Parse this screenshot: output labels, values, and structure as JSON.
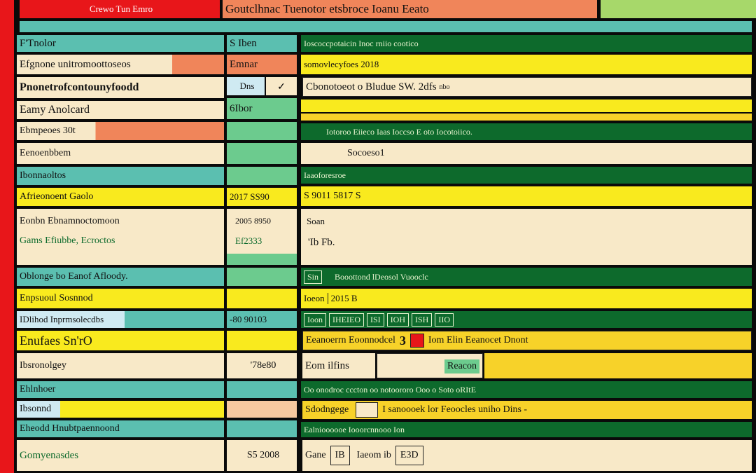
{
  "colors": {
    "red": "#e8161a",
    "teal": "#5bbfb0",
    "yellow": "#f9ea1e",
    "dark_green": "#0d6a2c",
    "gold": "#f7d229",
    "cream": "#f8e9c8",
    "orange": "#f0855a",
    "green": "#6ccb8e"
  },
  "header": {
    "left_tab": "Crewo Tun Emro",
    "center_title": "Goutclhnac Tuenotor etsbroce Ioanu Eeato"
  },
  "left": {
    "col1_header": "F'Tnolor",
    "col2_header": "S Iben",
    "rows": [
      {
        "label": "Efgnone unitromoottoseos",
        "value": "Emnar"
      },
      {
        "label": "Pnonetrofcontounyfoodd",
        "value": "Dns"
      },
      {
        "label": "Eamy Anolcard",
        "value": "6Ibor"
      },
      {
        "label": "Ebmpeoes 30t",
        "value": ""
      },
      {
        "label": "Eenoenbbem",
        "value": ""
      },
      {
        "label": "Ibonnaoltos",
        "value": ""
      },
      {
        "label": "Afrieonoent Gaolo",
        "value": "2017 SS90"
      },
      {
        "label": "Eonbn Ebnamnoctomoon",
        "value": "2005 8950"
      },
      {
        "label": "Gams Efiubbe, Ecroctos",
        "value": "Ef2333"
      },
      {
        "label": "Oblonge bo Eanof Afloody.",
        "value": ""
      },
      {
        "label": "Enpsuoul Sosnnod",
        "value": ""
      },
      {
        "label": "IDlihod Inprmsolecdbs",
        "value": "-80 90103"
      },
      {
        "label": "Enufaes Sn'rO",
        "value": ""
      },
      {
        "label": "Ibsronolgey",
        "value": "'78e80"
      },
      {
        "label": "Ehlnhoer",
        "value": ""
      },
      {
        "label": "Ibsonnd",
        "value": ""
      },
      {
        "label": "Eheodd Hnubtpaennoond",
        "value": ""
      },
      {
        "label": "Gomyenasdes",
        "value": "S5 2008"
      }
    ]
  },
  "right": {
    "row1": "Ioscoccpotaicin Inoc rniio cootico",
    "row2": "somovlecyfoes 2018",
    "row3": "Cbonotoeot o Bludue SW. 2dfs",
    "row3_small": "nbo",
    "row5": "Iotoroo Eiieco Iaas Ioccso E oto Iocotoiico.",
    "row6": "Socoeso1",
    "row7": "Iaaoforesroe",
    "row8": "S 9011 5817 S",
    "row9a": "Soan",
    "row9b": "'Ib Fb.",
    "row10_a": "Sin",
    "row10_b": "Booottond lDeosol Vuooclc",
    "row11_a": "Ioeon",
    "row11_b": "2015 B",
    "row12_items": [
      "Ioon",
      "IHEIEO",
      "ISI",
      "IOH",
      "ISH",
      "IIO"
    ],
    "row13_a": "Eeanoerrn Eoonnodcel",
    "row13_b": "3",
    "row13_c": "Iom Elin Eeanocet Dnont",
    "row14_a": "Eom ilfins",
    "row14_b": "Reacon",
    "row15": "Oo onodroc cccton oo notoororo Ooo o Soto oRItE",
    "row16_a": "Sdodngege",
    "row16_b": "I sanoooek lor Feoocles uniho Dins -",
    "row17": "Ealnioooooe Iooorcnnooo Ion",
    "row18_a": "Gane",
    "row18_b": "IB",
    "row18_c": "Iaeom ib",
    "row18_d": "E3D"
  }
}
